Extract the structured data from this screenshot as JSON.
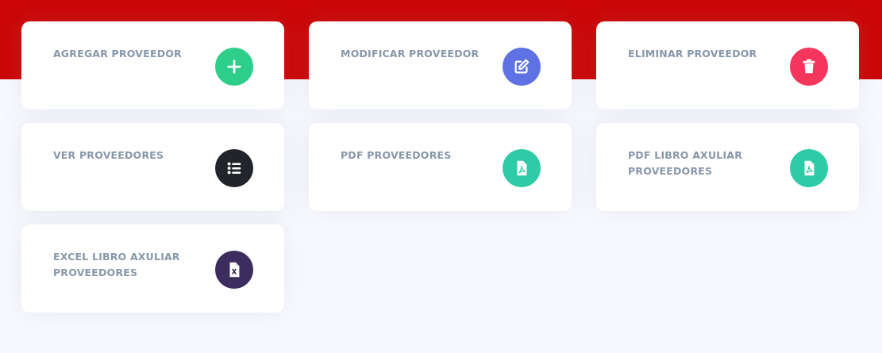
{
  "cards": [
    {
      "title": "AGREGAR PROVEEDOR",
      "kind": "plus",
      "color": "#2dce89"
    },
    {
      "title": "MODIFICAR PROVEEDOR",
      "kind": "edit",
      "color": "#5e72e4"
    },
    {
      "title": "ELIMINAR PROVEEDOR",
      "kind": "trash",
      "color": "#f5365c"
    },
    {
      "title": "VER PROVEEDORES",
      "kind": "list",
      "color": "#212529"
    },
    {
      "title": "PDF PROVEEDORES",
      "kind": "pdf",
      "color": "#2dcca7"
    },
    {
      "title": "PDF LIBRO AXULIAR PROVEEDORES",
      "kind": "pdf",
      "color": "#2dcca7"
    },
    {
      "title": "EXCEL LIBRO AXULIAR PROVEEDORES",
      "kind": "excel",
      "color": "#3b2d5e"
    }
  ]
}
